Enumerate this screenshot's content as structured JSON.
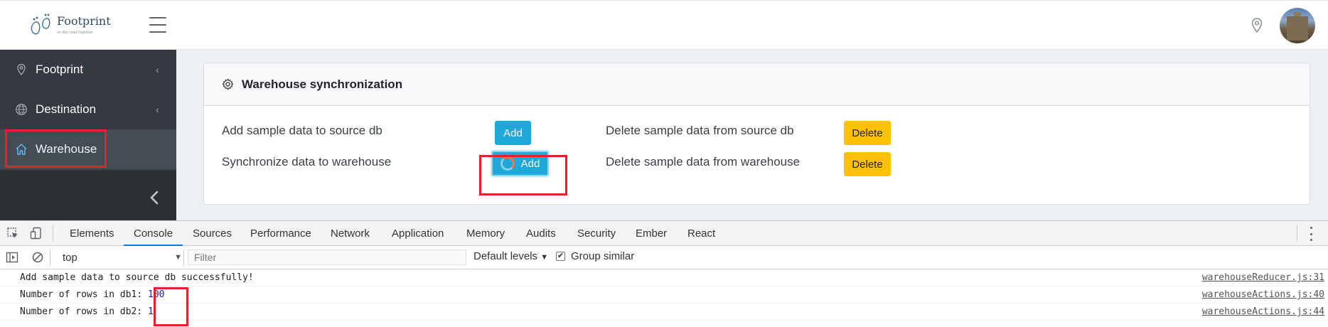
{
  "header": {
    "logo_title": "Footprint",
    "logo_subtitle": "on the road together",
    "menu_icon": "hamburger-icon",
    "location_icon": "map-pin-icon",
    "avatar_icon": "user-avatar"
  },
  "sidebar": {
    "items": [
      {
        "label": "Footprint",
        "icon": "map-pin-icon",
        "chevron": "‹"
      },
      {
        "label": "Destination",
        "icon": "globe-icon",
        "chevron": "‹"
      },
      {
        "label": "Warehouse",
        "icon": "home-icon"
      }
    ],
    "collapse_icon": "chevron-left-icon"
  },
  "card": {
    "title": "Warehouse synchronization",
    "icon": "gear-icon",
    "rows": [
      {
        "label": "Add sample data to source db",
        "action": "Add",
        "delete_label": "Delete sample data from source db",
        "delete_action": "Delete"
      },
      {
        "label": "Synchronize data to warehouse",
        "action": "Add",
        "delete_label": "Delete sample data from warehouse",
        "delete_action": "Delete"
      }
    ]
  },
  "devtools": {
    "tabs": [
      "Elements",
      "Console",
      "Sources",
      "Performance",
      "Network",
      "Application",
      "Memory",
      "Audits",
      "Security",
      "Ember",
      "React"
    ],
    "active_tab": "Console",
    "context": "top",
    "filter_placeholder": "Filter",
    "levels": "Default levels",
    "group_similar": "Group similar",
    "group_similar_checked": true,
    "logs": [
      {
        "message": "Add sample data to source db successfully!",
        "value": "",
        "source": "warehouseReducer.js:31"
      },
      {
        "message": "Number of rows in db1: ",
        "value": "100",
        "source": "warehouseActions.js:40"
      },
      {
        "message": "Number of rows in db2: ",
        "value": "1",
        "source": "warehouseActions.js:44"
      }
    ]
  },
  "colors": {
    "sidebar_bg": "#343a40",
    "primary_button": "#1fa8d8",
    "warning_button": "#ffc107",
    "highlight": "#e3222e",
    "devtools_active_tab": "#1a73e8"
  }
}
